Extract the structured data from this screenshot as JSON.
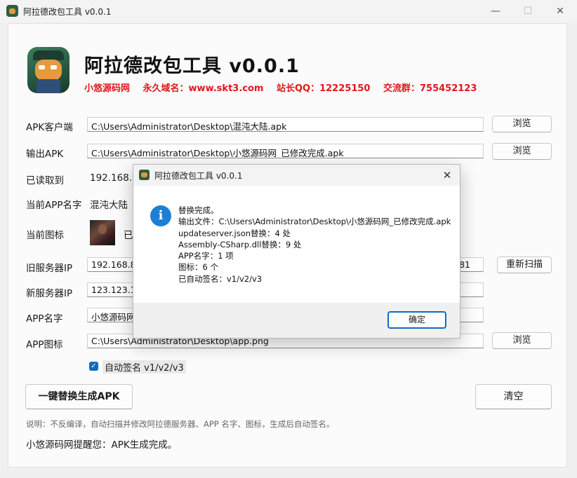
{
  "window": {
    "title": "阿拉德改包工具 v0.0.1",
    "min_icon": "minimize-icon",
    "max_icon": "maximize-icon",
    "close_icon": "close-icon"
  },
  "header": {
    "title": "阿拉德改包工具 v0.0.1",
    "info": [
      "小悠源码网",
      "永久域名：www.skt3.com",
      "站长QQ：12225150",
      "交流群：755452123"
    ]
  },
  "form": {
    "apk_client_label": "APK客户端",
    "apk_client_value": "C:\\Users\\Administrator\\Desktop\\混沌大陆.apk",
    "browse_label": "浏览",
    "output_label": "输出APK",
    "output_value": "C:\\Users\\Administrator\\Desktop\\小悠源码网_已修改完成.apk",
    "read_label": "已读取到",
    "read_value": "192.168.8.",
    "app_name_current_label": "当前APP名字",
    "app_name_current_value": "混沌大陆",
    "icon_current_label": "当前图标",
    "icon_current_text": "已",
    "old_server_label": "旧服务器IP",
    "old_server_value": "192.168.8.",
    "old_server_tail": "81",
    "rescan_label": "重新扫描",
    "new_server_label": "新服务器IP",
    "new_server_value": "123.123.12",
    "app_name_label": "APP名字",
    "app_name_value": "小悠源码网",
    "app_icon_label": "APP图标",
    "app_icon_value": "C:\\Users\\Administrator\\Desktop\\app.png",
    "auto_sign_label": "自动签名 v1/v2/v3",
    "auto_sign_checked": true
  },
  "actions": {
    "generate_label": "一键替换生成APK",
    "clear_label": "清空"
  },
  "note": "说明：不反编译，自动扫描并修改阿拉德服务器、APP 名字、图标，生成后自动签名。",
  "status": "小悠源码网提醒您：APK生成完成。",
  "dialog": {
    "title": "阿拉德改包工具 v0.0.1",
    "icon": "info-icon",
    "lines": [
      "替换完成。",
      "输出文件：C:\\Users\\Administrator\\Desktop\\小悠源码网_已修改完成.apk",
      "updateserver.json替换：4 处",
      "Assembly-CSharp.dll替换：9 处",
      "APP名字：1 项",
      "图标：6 个",
      "已自动签名：v1/v2/v3"
    ],
    "ok_label": "确定"
  },
  "colors": {
    "accent": "#0f6cbd",
    "info_text": "#e0171b",
    "info_icon": "#1c7fd6"
  }
}
